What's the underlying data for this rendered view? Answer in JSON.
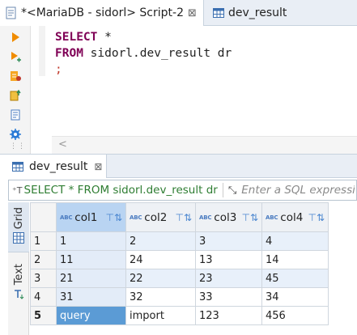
{
  "editor_tabs": [
    {
      "label": "*<MariaDB - sidorl> Script-2",
      "close": "⊠",
      "icon": "sql-script-icon"
    },
    {
      "label": "dev_result",
      "icon": "table-icon"
    }
  ],
  "sql": {
    "line1_kw": "SELECT",
    "line1_rest": " *",
    "line2_kw": "FROM",
    "line2_rest": " sidorl.dev_result dr",
    "line3": ";"
  },
  "gutter_icons": [
    "execute-statement-icon",
    "execute-script-icon",
    "explain-plan-icon",
    "load-script-icon",
    "export-icon",
    "settings-icon"
  ],
  "result_tab": {
    "label": "dev_result",
    "close": "⊠",
    "icon": "table-icon"
  },
  "filter": {
    "query_icon": "⁺T",
    "query_text": "SELECT * FROM sidorl.dev_result dr",
    "placeholder": "Enter a SQL expression to filter results"
  },
  "side_panel": {
    "grid_label": "Grid",
    "text_label": "Text"
  },
  "columns": [
    {
      "type": "ABC",
      "name": "col1"
    },
    {
      "type": "ABC",
      "name": "col2"
    },
    {
      "type": "ABC",
      "name": "col3"
    },
    {
      "type": "ABC",
      "name": "col4"
    }
  ],
  "rows": [
    {
      "n": "1",
      "cells": [
        "1",
        "2",
        "3",
        "4"
      ]
    },
    {
      "n": "2",
      "cells": [
        "11",
        "24",
        "13",
        "14"
      ]
    },
    {
      "n": "3",
      "cells": [
        "21",
        "22",
        "23",
        "45"
      ]
    },
    {
      "n": "4",
      "cells": [
        "31",
        "32",
        "33",
        "34"
      ]
    },
    {
      "n": "5",
      "cells": [
        "query",
        "import",
        "123",
        "456"
      ]
    }
  ],
  "colors": {
    "keyword": "#7f0055",
    "semicolon": "#c0392b",
    "filter_text": "#2e7d32",
    "selection": "#5b9bd5",
    "header_selected": "#b9d4f2",
    "row_stripe": "#e8f0fa"
  }
}
